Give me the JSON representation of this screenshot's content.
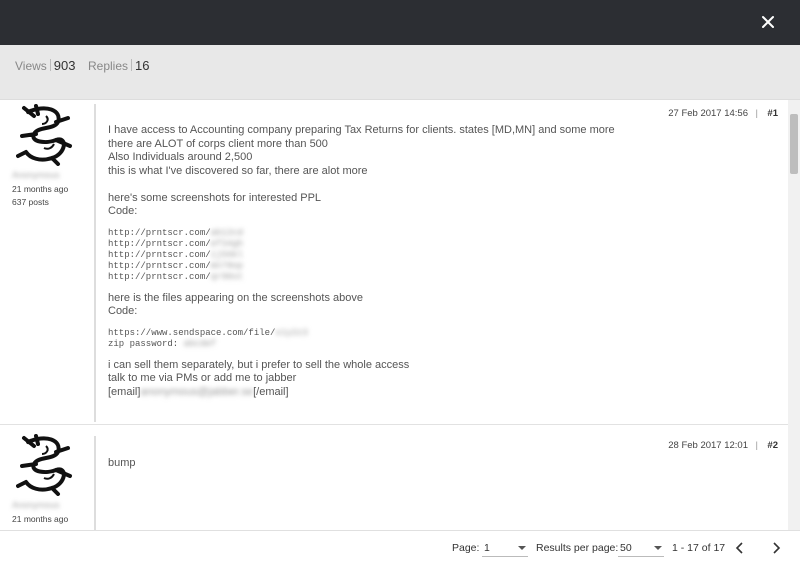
{
  "header": {
    "close_icon": "close-icon"
  },
  "stats": {
    "views_label": "Views",
    "views_value": "903",
    "replies_label": "Replies",
    "replies_value": "16"
  },
  "posts": [
    {
      "author": "Anonymous",
      "joined": "21 months ago",
      "post_count": "637 posts",
      "date": "27 Feb 2017 14:56",
      "separator": "|",
      "number": "#1",
      "lines": [
        "I have access to Accounting company preparing Tax Returns for clients. states [MD,MN] and some more",
        "there are ALOT of corps client more than 500",
        "Also Individuals around 2,500",
        "this is what I've discovered so far, there are alot more",
        "",
        "here's some screenshots for interested PPL",
        "Code:"
      ],
      "code1": [
        {
          "prefix": "http://prntscr.com/",
          "redacted": "ab12cd"
        },
        {
          "prefix": "http://prntscr.com/",
          "redacted": "ef34gh"
        },
        {
          "prefix": "http://prntscr.com/",
          "redacted": "ij56kl"
        },
        {
          "prefix": "http://prntscr.com/",
          "redacted": "mn78op"
        },
        {
          "prefix": "http://prntscr.com/",
          "redacted": "qr90st"
        }
      ],
      "lines2": [
        "here is the files appearing on the screenshots above",
        "Code:"
      ],
      "code2": [
        {
          "prefix": "https://www.sendspace.com/file/",
          "redacted": "x1y2z3"
        },
        {
          "prefix": "zip password: ",
          "redacted": "abcdef"
        }
      ],
      "lines3": [
        "i can sell them separately, but i prefer to sell the whole access",
        "talk to me via PMs or add me to jabber"
      ],
      "email_open": "[email]",
      "email_redacted": "anonymous@jabber.se",
      "email_close": "[/email]"
    },
    {
      "author": "Anonymous",
      "joined": "21 months ago",
      "date": "28 Feb 2017 12:01",
      "separator": "|",
      "number": "#2",
      "text": "bump"
    }
  ],
  "footer": {
    "page_label": "Page:",
    "page_value": "1",
    "rpp_label": "Results per page:",
    "rpp_value": "50",
    "range": "1 - 17 of 17",
    "prev_icon": "chevron-left-icon",
    "next_icon": "chevron-right-icon"
  }
}
